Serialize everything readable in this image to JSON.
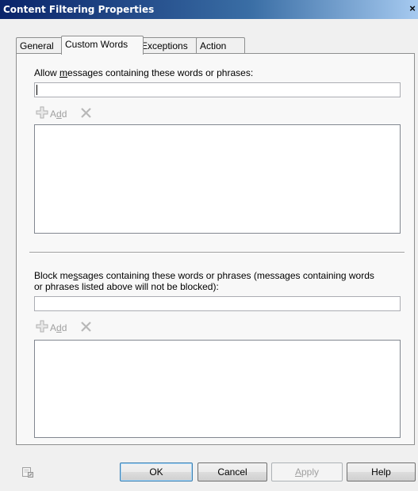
{
  "window": {
    "title": "Content Filtering Properties",
    "close_glyph": "×"
  },
  "tabs": [
    {
      "label": "General"
    },
    {
      "label": "Custom Words"
    },
    {
      "label": "Exceptions"
    },
    {
      "label": "Action"
    }
  ],
  "allow": {
    "label_pre": "Allow ",
    "label_ul": "m",
    "label_post": "essages containing these words or phrases:",
    "input_value": "",
    "add_pre": "A",
    "add_ul": "d",
    "add_post": "d"
  },
  "block": {
    "label_line1_pre": "Block me",
    "label_line1_ul": "s",
    "label_line1_post": "sages containing these words or phrases (messages containing words",
    "label_line2": "or phrases listed above will not be blocked):",
    "input_value": "",
    "add_pre": "A",
    "add_ul": "d",
    "add_post": "d"
  },
  "buttons": {
    "ok": "OK",
    "cancel": "Cancel",
    "apply_ul": "A",
    "apply_post": "pply",
    "help": "Help"
  },
  "icons": {
    "add": "plus-icon",
    "remove": "x-icon",
    "help": "context-help-icon"
  }
}
